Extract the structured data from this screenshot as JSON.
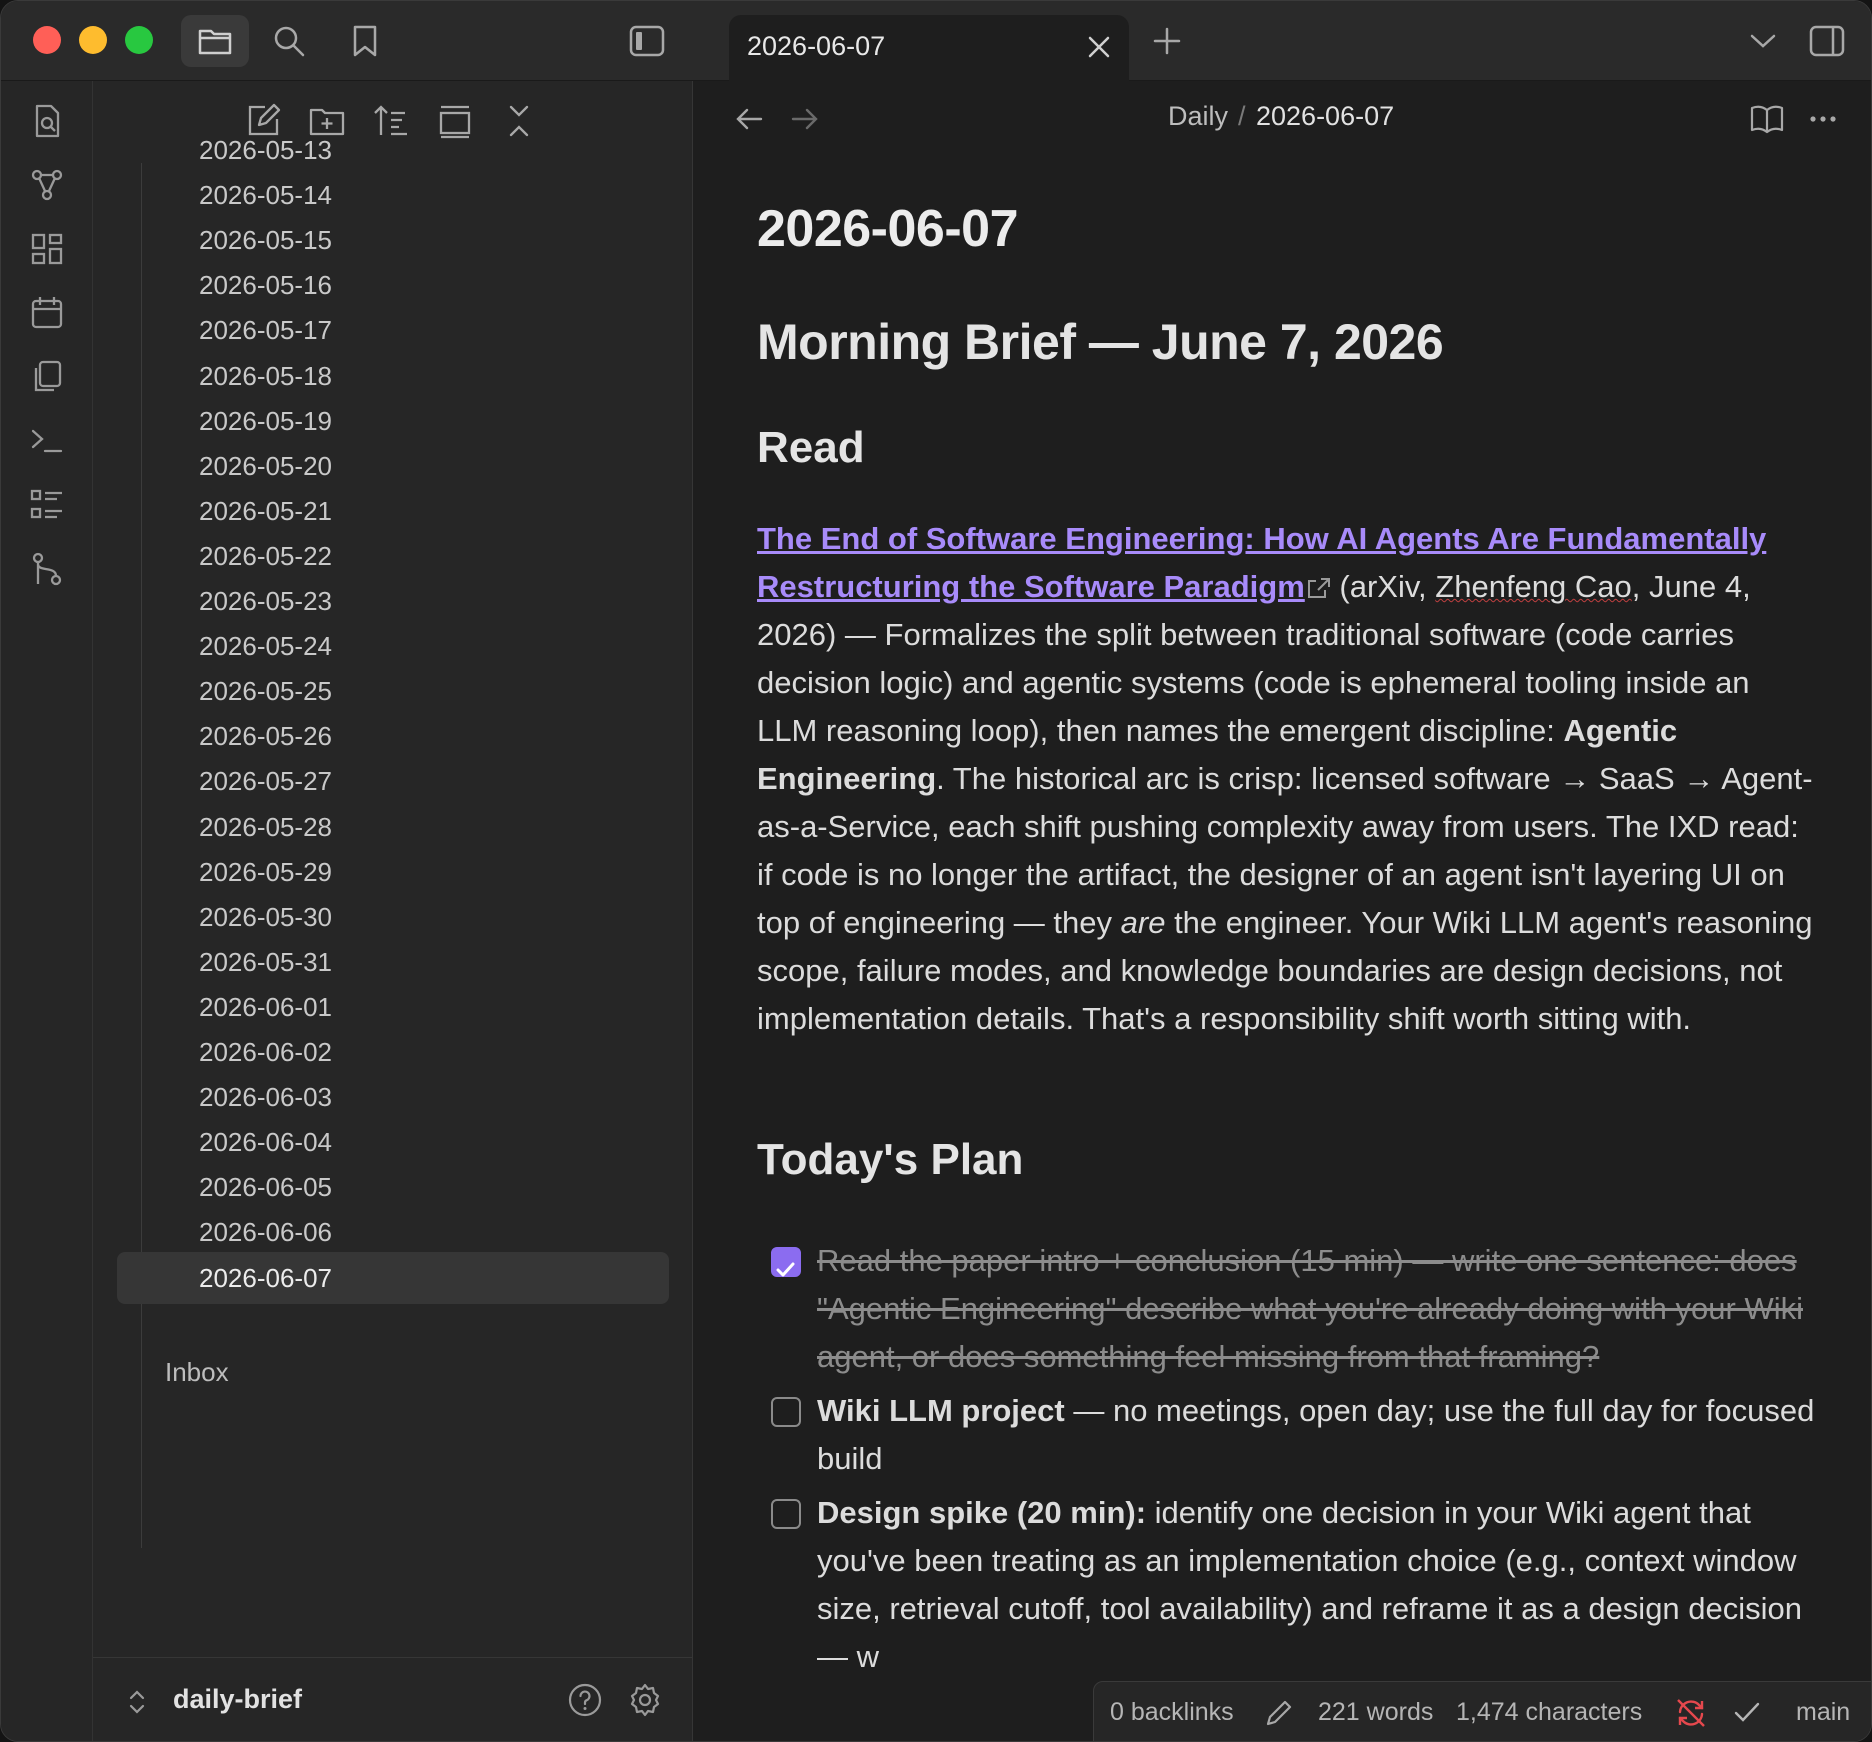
{
  "tab": {
    "title": "2026-06-07"
  },
  "breadcrumb": {
    "parent": "Daily",
    "sep": "/",
    "current": "2026-06-07"
  },
  "files": [
    "2026-05-13",
    "2026-05-14",
    "2026-05-15",
    "2026-05-16",
    "2026-05-17",
    "2026-05-18",
    "2026-05-19",
    "2026-05-20",
    "2026-05-21",
    "2026-05-22",
    "2026-05-23",
    "2026-05-24",
    "2026-05-25",
    "2026-05-26",
    "2026-05-27",
    "2026-05-28",
    "2026-05-29",
    "2026-05-30",
    "2026-05-31",
    "2026-06-01",
    "2026-06-02",
    "2026-06-03",
    "2026-06-04",
    "2026-06-05",
    "2026-06-06",
    "2026-06-07"
  ],
  "inbox": "Inbox",
  "vault": {
    "name": "daily-brief"
  },
  "note": {
    "title": "2026-06-07",
    "heading": "Morning Brief — June 7, 2026",
    "read_heading": "Read",
    "link_text": "The End of Software Engineering: How AI Agents Are Fundamentally Restructuring the Software Paradigm",
    "para_1": " (arXiv, ",
    "author": "Zhenfeng Cao",
    "para_2": ", June 4, 2026) — Formalizes the split between traditional software (code carries decision logic) and agentic systems (code is ephemeral tooling inside an LLM reasoning loop), then names the emergent discipline: ",
    "bold_1": "Agentic Engineering",
    "para_3": ". The historical arc is crisp: licensed software → SaaS → Agent-as-a-Service, each shift pushing complexity away from users. The IXD read: if code is no longer the artifact, the designer of an agent isn't layering UI on top of engineering — they ",
    "italic_1": "are",
    "para_4": " the engineer. Your Wiki LLM agent's reasoning scope, failure modes, and knowledge boundaries are design decisions, not implementation details. That's a responsibility shift worth sitting with.",
    "plan_heading": "Today's Plan",
    "tasks": [
      {
        "bold": "",
        "text": "Read the paper intro + conclusion (15 min) — write one sentence: does \"Agentic Engineering\" describe what you're already doing with your Wiki agent, or does something feel missing from that framing?"
      },
      {
        "bold": "Wiki LLM project",
        "text": " — no meetings, open day; use the full day for focused build"
      },
      {
        "bold": "Design spike (20 min):",
        "text": " identify one decision in your Wiki agent that you've been treating as an implementation choice (e.g., context window size, retrieval cutoff, tool availability) and reframe it as a design decision — w"
      }
    ]
  },
  "status": {
    "backlinks": "0 backlinks",
    "words": "221 words",
    "chars": "1,474 characters",
    "branch": "main"
  },
  "colors": {
    "accent": "#8b6cf0",
    "link": "#a88bfa",
    "sync_error": "#e5484d"
  }
}
